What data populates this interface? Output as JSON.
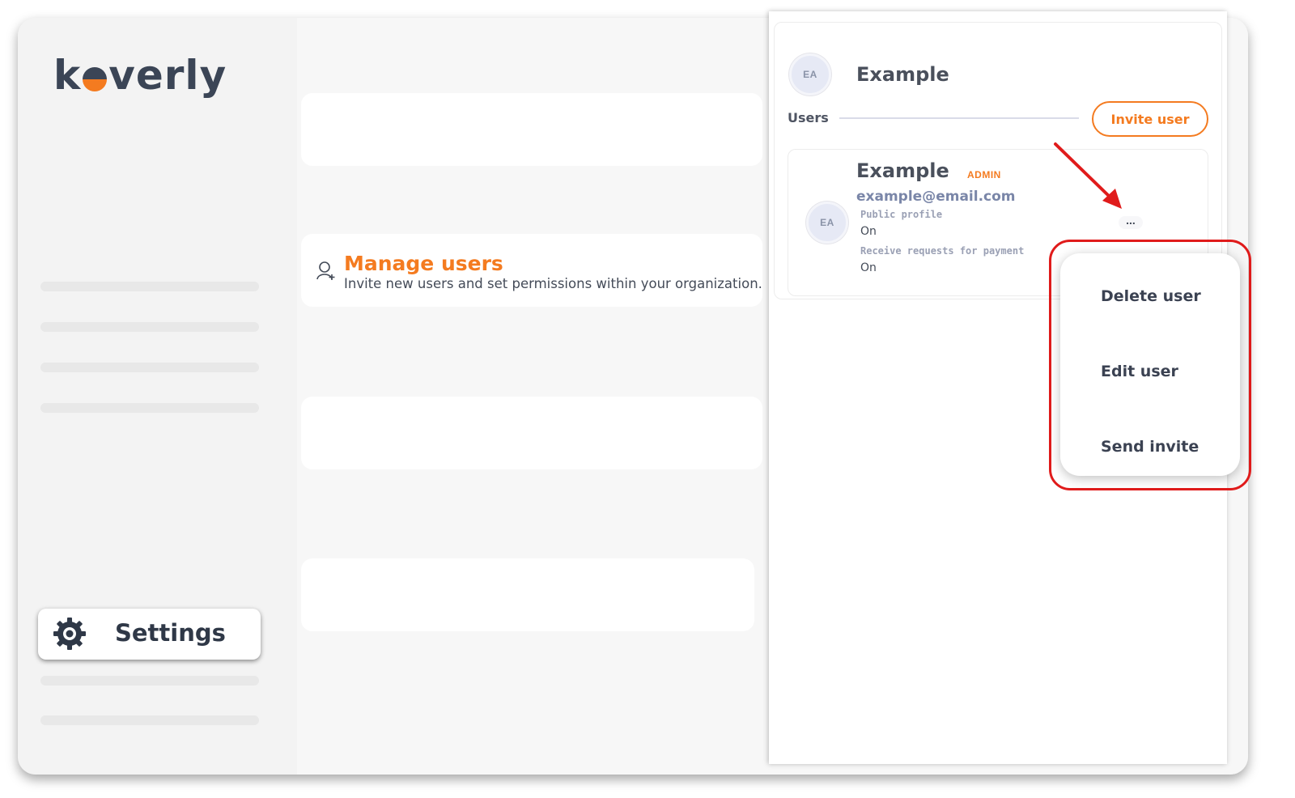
{
  "app": {
    "logo_text": [
      "k",
      "verly"
    ],
    "brand_color": "#f47b20"
  },
  "sidebar": {
    "settings_label": "Settings"
  },
  "main": {
    "manage_users": {
      "title": "Manage users",
      "description": "Invite new users and set permissions within your organization."
    }
  },
  "panel": {
    "org_avatar": "EA",
    "org_name": "Example",
    "users_label": "Users",
    "invite_button": "Invite user",
    "user": {
      "avatar": "EA",
      "name": "Example",
      "role_badge": "ADMIN",
      "email": "example@email.com",
      "public_profile_label": "Public profile",
      "public_profile_value": "On",
      "payment_requests_label": "Receive requests for payment",
      "payment_requests_value": "On",
      "more_label": "..."
    }
  },
  "dropdown": {
    "items": [
      "Delete user",
      "Edit user",
      "Send invite"
    ]
  },
  "annotation": {
    "highlight_color": "#e01b1b"
  }
}
